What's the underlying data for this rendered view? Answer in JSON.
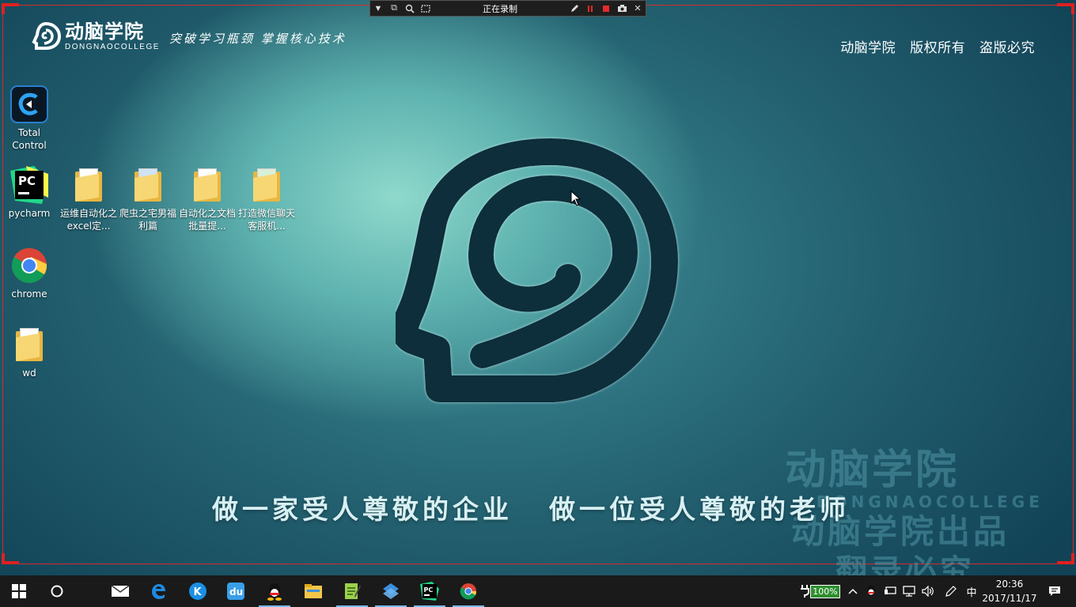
{
  "recorder": {
    "status_label": "正在录制"
  },
  "brand": {
    "name": "动脑学院",
    "subtitle": "DONGNAOCOLLEGE",
    "slogan": "突破学习瓶颈  掌握核心技术",
    "copyright": [
      "动脑学院",
      "版权所有",
      "盗版必究"
    ]
  },
  "desktop_icons": [
    {
      "label": "Total Control",
      "icon": "total-control-icon"
    },
    {
      "label": "pycharm",
      "icon": "pycharm-icon"
    },
    {
      "label": "chrome",
      "icon": "chrome-icon"
    },
    {
      "label": "wd",
      "icon": "folder-icon"
    },
    {
      "label": "运维自动化之excel定...",
      "icon": "folder-icon"
    },
    {
      "label": "爬虫之宅男福利篇",
      "icon": "folder-icon"
    },
    {
      "label": "自动化之文档批量提...",
      "icon": "folder-icon"
    },
    {
      "label": "打造微信聊天客服机...",
      "icon": "folder-icon"
    }
  ],
  "tagline": {
    "left": "做一家受人尊敬的企业",
    "right": "做一位受人尊敬的老师"
  },
  "watermark": {
    "line1": "动脑学院",
    "line2": "DONGNAOCOLLEGE",
    "line3": "动脑学院出品",
    "line4": "翻录必究"
  },
  "taskbar": {
    "apps": [
      "start-icon",
      "cortana-icon",
      "mail-icon",
      "edge-icon",
      "kugou-icon",
      "baidu-pinyin-icon",
      "qq-icon",
      "file-explorer-icon",
      "notepad-plus-icon",
      "vmware-icon",
      "pycharm-icon",
      "chrome-icon"
    ],
    "battery": "100%",
    "ime": "中",
    "time": "20:36",
    "date": "2017/11/17"
  },
  "colors": {
    "logo_dark": "#0d2e3a",
    "accent_red": "#e02020",
    "taskbar_bg": "#1a1a1a"
  }
}
